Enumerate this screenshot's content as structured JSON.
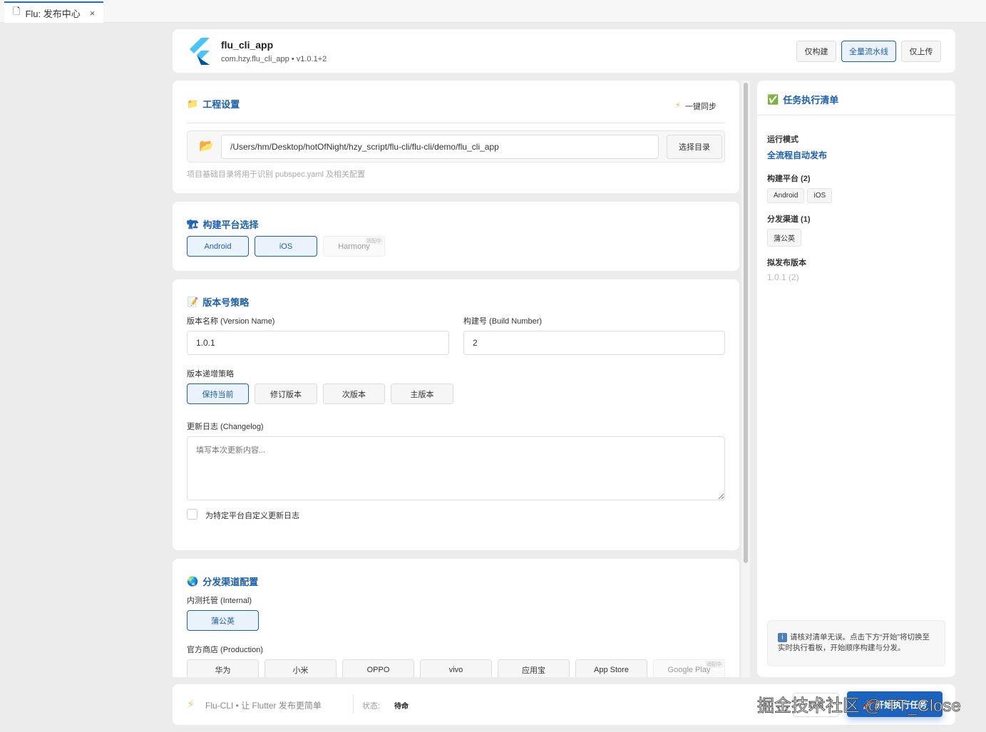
{
  "tab": {
    "title": "Flu: 发布中心",
    "close": "×"
  },
  "header": {
    "app_name": "flu_cli_app",
    "app_meta": "com.hzy.flu_cli_app • v1.0.1+2",
    "buttons": [
      "仅构建",
      "全量流水线",
      "仅上传"
    ],
    "selected_button": "全量流水线"
  },
  "project": {
    "title": "工程设置",
    "sync_label": "一键同步",
    "path": "/Users/hm/Desktop/hotOfNight/hzy_script/flu-cli/flu-cli/demo/flu_cli_app",
    "choose_dir": "选择目录",
    "hint": "项目基础目录将用于识别 pubspec.yaml 及相关配置"
  },
  "platform": {
    "title": "构建平台选择",
    "items": [
      {
        "label": "Android",
        "selected": true
      },
      {
        "label": "iOS",
        "selected": true
      },
      {
        "label": "Harmony",
        "selected": false,
        "badge": "适配中"
      }
    ]
  },
  "version": {
    "title": "版本号策略",
    "name_label": "版本名称 (Version Name)",
    "name_value": "1.0.1",
    "build_label": "构建号 (Build Number)",
    "build_value": "2",
    "strategy_label": "版本递增策略",
    "strategies": [
      "保持当前",
      "修订版本",
      "次版本",
      "主版本"
    ],
    "changelog_label": "更新日志 (Changelog)",
    "changelog_placeholder": "填写本次更新内容...",
    "custom_changelog": "为特定平台自定义更新日志"
  },
  "channels": {
    "title": "分发渠道配置",
    "internal_label": "内测托管 (Internal)",
    "internal": [
      "蒲公英"
    ],
    "production_label": "官方商店 (Production)",
    "production": [
      "华为",
      "小米",
      "OPPO",
      "vivo",
      "应用宝",
      "App Store",
      "Google Play"
    ],
    "production_badge": "适配中"
  },
  "checklist": {
    "title": "任务执行清单",
    "mode_label": "运行模式",
    "mode_value": "全流程自动发布",
    "platforms_label": "构建平台 (2)",
    "platforms": [
      "Android",
      "iOS"
    ],
    "channels_label": "分发渠道 (1)",
    "channels": [
      "蒲公英"
    ],
    "version_label": "拟发布版本",
    "version_value": "1.0.1 (2)",
    "notice": "请核对清单无误。点击下方“开始”将切换至实时执行看板，开始顺序构建与分发。"
  },
  "footer": {
    "brand": "Flu-CLI • 让 Flutter 发布更简单",
    "status_label": "状态:",
    "status_value": "待命",
    "secondary_button": "取消",
    "start_button": "🚀 开始执行任务"
  },
  "watermark": "掘金技术社区 @ TT_Close",
  "colors": {
    "accent": "#1b5fae",
    "background": "#ececec"
  }
}
